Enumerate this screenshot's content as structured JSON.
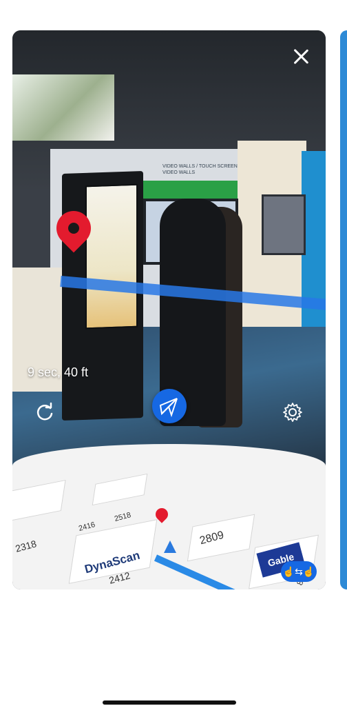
{
  "ar_view": {
    "eta_text": "9 sec, 40 ft",
    "wall_sign_text": "VIDEO WALLS / TOUCH SCREEN VIDEO WALLS",
    "close_icon": "close-icon",
    "refresh_icon": "refresh-icon",
    "navigate_icon": "compass-navigation-icon",
    "settings_icon": "gear-icon",
    "destination_icon": "map-pin-icon",
    "accent_color": "#1668e3",
    "pin_color": "#e31b2e"
  },
  "map": {
    "booth_labels": [
      "2318",
      "DynaScan",
      "2412",
      "2416",
      "2518",
      "2809",
      "Gable",
      "805"
    ],
    "gesture_icon": "touch-gesture-icon"
  }
}
